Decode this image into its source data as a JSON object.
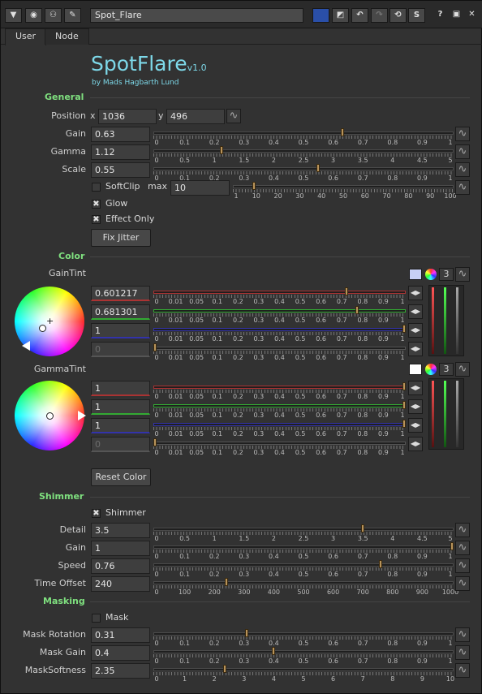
{
  "titlebar": {
    "node_name": "Spot_Flare",
    "icons": [
      "menu-arrow-icon",
      "settings-icon",
      "node-graph-icon",
      "wrench-icon",
      "color-swatch-icon",
      "eraser-icon",
      "undo-icon",
      "redo-icon",
      "revert-icon",
      "s-icon",
      "help-icon",
      "float-icon",
      "close-icon"
    ],
    "labels": {
      "help": "?",
      "float": "▣",
      "close": "✕",
      "s": "S"
    }
  },
  "tabs": [
    "User",
    "Node"
  ],
  "header": {
    "title": "SpotFlare",
    "version": "v1.0",
    "author": "by Mads Hagbarth Lund"
  },
  "general": {
    "title": "General",
    "position": {
      "label": "Position",
      "x_label": "x",
      "x": "1036",
      "y_label": "y",
      "y": "496"
    },
    "gain": {
      "label": "Gain",
      "value": "0.63",
      "ticks": [
        "0",
        "0.1",
        "0.2",
        "0.3",
        "0.4",
        "0.5",
        "0.6",
        "0.7",
        "0.8",
        "0.9",
        "1"
      ],
      "level": 0.63
    },
    "gamma": {
      "label": "Gamma",
      "value": "1.12",
      "ticks": [
        "0",
        "0.5",
        "1",
        "1.5",
        "2",
        "2.5",
        "3",
        "3.5",
        "4",
        "4.5",
        "5"
      ],
      "level": 0.224
    },
    "scale": {
      "label": "Scale",
      "value": "0.55",
      "ticks": [
        "0",
        "0.1",
        "0.2",
        "0.3",
        "0.4",
        "0.5",
        "0.6",
        "0.7",
        "0.8",
        "0.9",
        "1"
      ],
      "level": 0.55
    },
    "softclip": {
      "label": "SoftClip",
      "max_label": "max",
      "max": "10",
      "ticks": [
        "1",
        "10",
        "20",
        "30",
        "40",
        "50",
        "60",
        "70",
        "80",
        "90",
        "100"
      ],
      "level": 0.09
    },
    "glow": {
      "label": "Glow",
      "checked": true
    },
    "effect_only": {
      "label": "Effect Only",
      "checked": true
    },
    "fix_jitter": "Fix Jitter"
  },
  "color": {
    "title": "Color",
    "gaintint": {
      "label": "GainTint",
      "channels": [
        "3"
      ],
      "values": [
        "0.601217",
        "0.681301",
        "1",
        "0"
      ],
      "levels": [
        0.77,
        0.81,
        1,
        0
      ]
    },
    "gammatint": {
      "label": "GammaTint",
      "channels": [
        "3"
      ],
      "values": [
        "1",
        "1",
        "1",
        "0"
      ],
      "levels": [
        1,
        1,
        1,
        0
      ]
    },
    "tint_ticks": [
      "0",
      "0.01",
      "0.05",
      "0.1",
      "0.2",
      "0.3",
      "0.4",
      "0.5",
      "0.6",
      "0.7",
      "0.8",
      "0.9",
      "1"
    ],
    "reset": "Reset Color"
  },
  "shimmer": {
    "title": "Shimmer",
    "enable": {
      "label": "Shimmer",
      "checked": true
    },
    "detail": {
      "label": "Detail",
      "value": "3.5",
      "ticks": [
        "0",
        "0.5",
        "1",
        "1.5",
        "2",
        "2.5",
        "3",
        "3.5",
        "4",
        "4.5",
        "5"
      ],
      "level": 0.7
    },
    "gain": {
      "label": "Gain",
      "value": "1",
      "ticks": [
        "0",
        "0.1",
        "0.2",
        "0.3",
        "0.4",
        "0.5",
        "0.6",
        "0.7",
        "0.8",
        "0.9",
        "1"
      ],
      "level": 1
    },
    "speed": {
      "label": "Speed",
      "value": "0.76",
      "ticks": [
        "0",
        "0.1",
        "0.2",
        "0.3",
        "0.4",
        "0.5",
        "0.6",
        "0.7",
        "0.8",
        "0.9",
        "1"
      ],
      "level": 0.76
    },
    "time_offset": {
      "label": "Time Offset",
      "value": "240",
      "ticks": [
        "0",
        "100",
        "200",
        "300",
        "400",
        "500",
        "600",
        "700",
        "800",
        "900",
        "1000"
      ],
      "level": 0.24
    }
  },
  "masking": {
    "title": "Masking",
    "mask": {
      "label": "Mask",
      "checked": false
    },
    "rotation": {
      "label": "Mask Rotation",
      "value": "0.31",
      "ticks": [
        "0",
        "0.1",
        "0.2",
        "0.3",
        "0.4",
        "0.5",
        "0.6",
        "0.7",
        "0.8",
        "0.9",
        "1"
      ],
      "level": 0.31
    },
    "gain": {
      "label": "Mask Gain",
      "value": "0.4",
      "ticks": [
        "0",
        "0.1",
        "0.2",
        "0.3",
        "0.4",
        "0.5",
        "0.6",
        "0.7",
        "0.8",
        "0.9",
        "1"
      ],
      "level": 0.4
    },
    "softness": {
      "label": "MaskSoftness",
      "value": "2.35",
      "ticks": [
        "0",
        "1",
        "2",
        "3",
        "4",
        "5",
        "6",
        "7",
        "8",
        "9",
        "10"
      ],
      "level": 0.235
    }
  },
  "colors": {
    "section": "#7fe07f",
    "title": "#7dd8e8",
    "handle": "#b8935a"
  }
}
